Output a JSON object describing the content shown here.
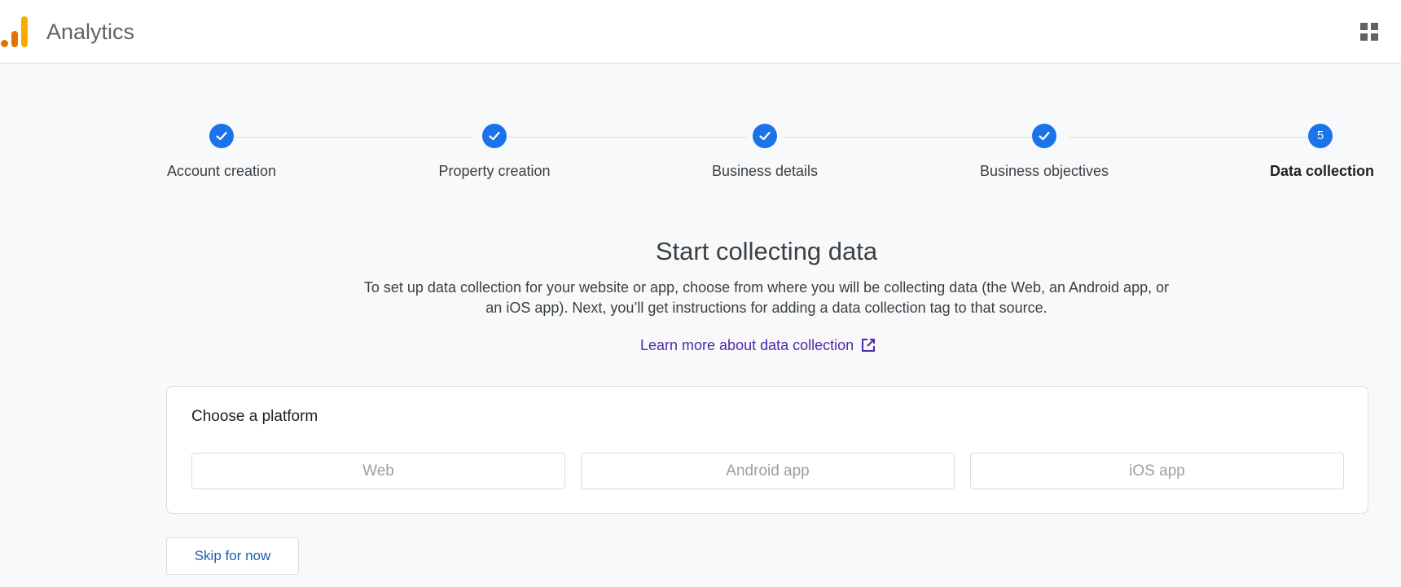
{
  "header": {
    "app_title": "Analytics",
    "logo_icon": "analytics-logo",
    "apps_icon": "apps-grid-icon",
    "brand_colors": [
      "#f9ab00",
      "#e37400"
    ]
  },
  "stepper": {
    "steps": [
      {
        "label": "Account creation",
        "state": "complete",
        "icon": "check-icon"
      },
      {
        "label": "Property creation",
        "state": "complete",
        "icon": "check-icon"
      },
      {
        "label": "Business details",
        "state": "complete",
        "icon": "check-icon"
      },
      {
        "label": "Business objectives",
        "state": "complete",
        "icon": "check-icon"
      },
      {
        "label": "Data collection",
        "state": "current",
        "number": "5"
      }
    ],
    "accent_color": "#1a73e8"
  },
  "main": {
    "heading": "Start collecting data",
    "description": "To set up data collection for your website or app, choose from where you will be collecting data (the Web, an Android app, or an iOS app). Next, you’ll get instructions for adding a data collection tag to that source.",
    "learn_more_link": "Learn more about data collection",
    "learn_more_icon": "open-in-new-icon"
  },
  "platform_card": {
    "title": "Choose a platform",
    "options": [
      "Web",
      "Android app",
      "iOS app"
    ]
  },
  "footer": {
    "skip_label": "Skip for now"
  }
}
